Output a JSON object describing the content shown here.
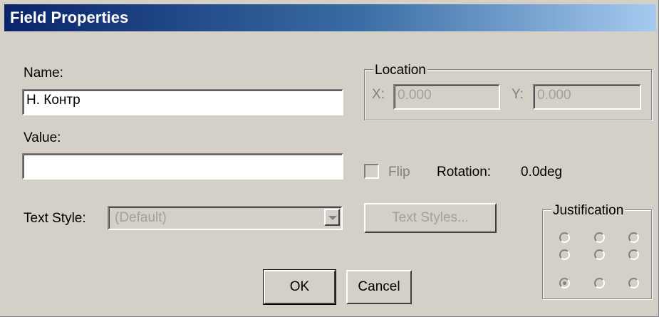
{
  "window": {
    "title": "Field Properties"
  },
  "name": {
    "label": "Name:",
    "value": "Н. Контр"
  },
  "value": {
    "label": "Value:",
    "value": ""
  },
  "location": {
    "legend": "Location",
    "x_label": "X:",
    "x_value": "0.000",
    "y_label": "Y:",
    "y_value": "0.000"
  },
  "flip": {
    "label": "Flip",
    "checked": false
  },
  "rotation": {
    "label": "Rotation:",
    "value": "0.0deg"
  },
  "text_style": {
    "label": "Text Style:",
    "selected": "(Default)",
    "icon": "chevron-down-icon"
  },
  "text_styles_button": {
    "label": "Text Styles..."
  },
  "justification": {
    "legend": "Justification",
    "selected": "bottom-left",
    "options": [
      "top-left",
      "top-center",
      "top-right",
      "middle-left",
      "middle-center",
      "middle-right",
      "bottom-left",
      "bottom-center",
      "bottom-right"
    ]
  },
  "buttons": {
    "ok": "OK",
    "cancel": "Cancel"
  }
}
